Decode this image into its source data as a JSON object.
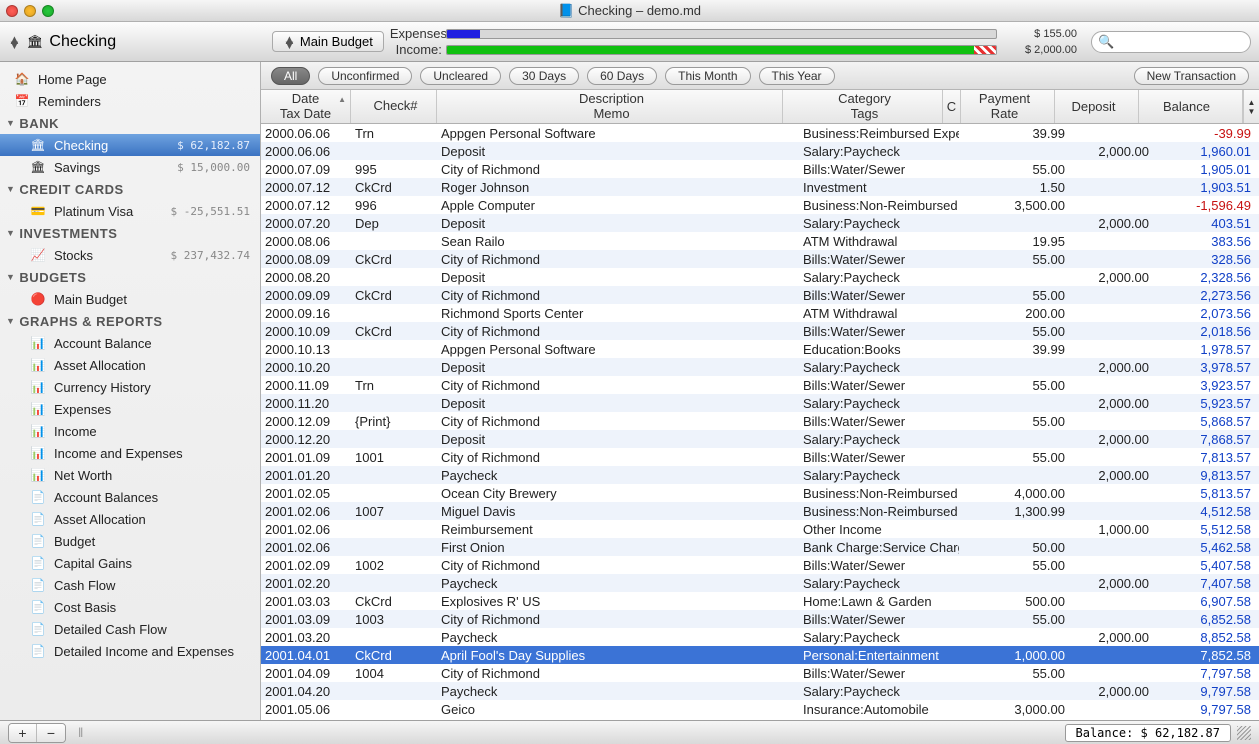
{
  "window": {
    "title": "Checking – demo.md"
  },
  "toolbar": {
    "account_label": "Checking",
    "budget_label": "Main Budget",
    "expenses_label": "Expenses:",
    "income_label": "Income:",
    "expenses_amount": "$ 155.00",
    "income_amount": "$ 2,000.00",
    "expense_fill_pct": 6,
    "income_fill_pct": 96
  },
  "sidebar": {
    "top": [
      {
        "label": "Home Page",
        "icon": "🏠"
      },
      {
        "label": "Reminders",
        "icon": "📅"
      }
    ],
    "groups": [
      {
        "title": "BANK",
        "items": [
          {
            "label": "Checking",
            "amount": "$ 62,182.87",
            "selected": true,
            "icon": "🏛"
          },
          {
            "label": "Savings",
            "amount": "$ 15,000.00",
            "icon": "🏛"
          }
        ]
      },
      {
        "title": "CREDIT CARDS",
        "items": [
          {
            "label": "Platinum Visa",
            "amount": "$ -25,551.51",
            "icon": "💳"
          }
        ]
      },
      {
        "title": "INVESTMENTS",
        "items": [
          {
            "label": "Stocks",
            "amount": "$ 237,432.74",
            "icon": "📈"
          }
        ]
      },
      {
        "title": "BUDGETS",
        "items": [
          {
            "label": "Main Budget",
            "icon": "🔴"
          }
        ]
      },
      {
        "title": "GRAPHS & REPORTS",
        "items": [
          {
            "label": "Account Balance",
            "icon": "📊"
          },
          {
            "label": "Asset Allocation",
            "icon": "📊"
          },
          {
            "label": "Currency History",
            "icon": "📊"
          },
          {
            "label": "Expenses",
            "icon": "📊"
          },
          {
            "label": "Income",
            "icon": "📊"
          },
          {
            "label": "Income and Expenses",
            "icon": "📊"
          },
          {
            "label": "Net Worth",
            "icon": "📊"
          },
          {
            "label": "Account Balances",
            "icon": "📄"
          },
          {
            "label": "Asset Allocation",
            "icon": "📄"
          },
          {
            "label": "Budget",
            "icon": "📄"
          },
          {
            "label": "Capital Gains",
            "icon": "📄"
          },
          {
            "label": "Cash Flow",
            "icon": "📄"
          },
          {
            "label": "Cost Basis",
            "icon": "📄"
          },
          {
            "label": "Detailed Cash Flow",
            "icon": "📄"
          },
          {
            "label": "Detailed Income and Expenses",
            "icon": "📄"
          }
        ]
      }
    ]
  },
  "filters": {
    "pills": [
      "All",
      "Unconfirmed",
      "Uncleared",
      "30 Days",
      "60 Days",
      "This Month",
      "This Year"
    ],
    "active": 0,
    "new_tx": "New Transaction"
  },
  "columns": {
    "date": [
      "Date",
      "Tax Date"
    ],
    "check": [
      "Check#",
      ""
    ],
    "desc": [
      "Description",
      "Memo"
    ],
    "cat": [
      "Category",
      "Tags"
    ],
    "c": [
      "C",
      ""
    ],
    "pay": [
      "Payment",
      "Rate"
    ],
    "dep": [
      "Deposit",
      ""
    ],
    "bal": [
      "Balance",
      ""
    ]
  },
  "transactions": [
    {
      "date": "2000.06.06",
      "check": "Trn",
      "desc": "Appgen Personal Software",
      "cat": "Business:Reimbursed Expenses",
      "pay": "39.99",
      "dep": "",
      "bal": "-39.99",
      "neg": true
    },
    {
      "date": "2000.06.06",
      "check": "",
      "desc": "Deposit",
      "cat": "Salary:Paycheck",
      "pay": "",
      "dep": "2,000.00",
      "bal": "1,960.01"
    },
    {
      "date": "2000.07.09",
      "check": "995",
      "desc": "City of Richmond",
      "cat": "Bills:Water/Sewer",
      "pay": "55.00",
      "dep": "",
      "bal": "1,905.01"
    },
    {
      "date": "2000.07.12",
      "check": "CkCrd",
      "desc": "Roger Johnson",
      "cat": "Investment",
      "pay": "1.50",
      "dep": "",
      "bal": "1,903.51"
    },
    {
      "date": "2000.07.12",
      "check": "996",
      "desc": "Apple Computer",
      "cat": "Business:Non-Reimbursed Expenses",
      "pay": "3,500.00",
      "dep": "",
      "bal": "-1,596.49",
      "neg": true
    },
    {
      "date": "2000.07.20",
      "check": "Dep",
      "desc": "Deposit",
      "cat": "Salary:Paycheck",
      "pay": "",
      "dep": "2,000.00",
      "bal": "403.51"
    },
    {
      "date": "2000.08.06",
      "check": "",
      "desc": "Sean Railo",
      "cat": "ATM Withdrawal",
      "pay": "19.95",
      "dep": "",
      "bal": "383.56"
    },
    {
      "date": "2000.08.09",
      "check": "CkCrd",
      "desc": "City of Richmond",
      "cat": "Bills:Water/Sewer",
      "pay": "55.00",
      "dep": "",
      "bal": "328.56"
    },
    {
      "date": "2000.08.20",
      "check": "",
      "desc": "Deposit",
      "cat": "Salary:Paycheck",
      "pay": "",
      "dep": "2,000.00",
      "bal": "2,328.56"
    },
    {
      "date": "2000.09.09",
      "check": "CkCrd",
      "desc": "City of Richmond",
      "cat": "Bills:Water/Sewer",
      "pay": "55.00",
      "dep": "",
      "bal": "2,273.56"
    },
    {
      "date": "2000.09.16",
      "check": "",
      "desc": "Richmond Sports Center",
      "cat": "ATM Withdrawal",
      "pay": "200.00",
      "dep": "",
      "bal": "2,073.56"
    },
    {
      "date": "2000.10.09",
      "check": "CkCrd",
      "desc": "City of Richmond",
      "cat": "Bills:Water/Sewer",
      "pay": "55.00",
      "dep": "",
      "bal": "2,018.56"
    },
    {
      "date": "2000.10.13",
      "check": "",
      "desc": "Appgen Personal Software",
      "cat": "Education:Books",
      "pay": "39.99",
      "dep": "",
      "bal": "1,978.57"
    },
    {
      "date": "2000.10.20",
      "check": "",
      "desc": "Deposit",
      "cat": "Salary:Paycheck",
      "pay": "",
      "dep": "2,000.00",
      "bal": "3,978.57"
    },
    {
      "date": "2000.11.09",
      "check": "Trn",
      "desc": "City of Richmond",
      "cat": "Bills:Water/Sewer",
      "pay": "55.00",
      "dep": "",
      "bal": "3,923.57"
    },
    {
      "date": "2000.11.20",
      "check": "",
      "desc": "Deposit",
      "cat": "Salary:Paycheck",
      "pay": "",
      "dep": "2,000.00",
      "bal": "5,923.57"
    },
    {
      "date": "2000.12.09",
      "check": "{Print}",
      "desc": "City of Richmond",
      "cat": "Bills:Water/Sewer",
      "pay": "55.00",
      "dep": "",
      "bal": "5,868.57"
    },
    {
      "date": "2000.12.20",
      "check": "",
      "desc": "Deposit",
      "cat": "Salary:Paycheck",
      "pay": "",
      "dep": "2,000.00",
      "bal": "7,868.57"
    },
    {
      "date": "2001.01.09",
      "check": "1001",
      "desc": "City of Richmond",
      "cat": "Bills:Water/Sewer",
      "pay": "55.00",
      "dep": "",
      "bal": "7,813.57"
    },
    {
      "date": "2001.01.20",
      "check": "",
      "desc": "Paycheck",
      "cat": "Salary:Paycheck",
      "pay": "",
      "dep": "2,000.00",
      "bal": "9,813.57"
    },
    {
      "date": "2001.02.05",
      "check": "",
      "desc": "Ocean City Brewery",
      "cat": "Business:Non-Reimbursed Expenses",
      "pay": "4,000.00",
      "dep": "",
      "bal": "5,813.57"
    },
    {
      "date": "2001.02.06",
      "check": "1007",
      "desc": "Miguel Davis",
      "cat": "Business:Non-Reimbursed Expenses",
      "pay": "1,300.99",
      "dep": "",
      "bal": "4,512.58"
    },
    {
      "date": "2001.02.06",
      "check": "",
      "desc": "Reimbursement",
      "cat": "Other Income",
      "pay": "",
      "dep": "1,000.00",
      "bal": "5,512.58"
    },
    {
      "date": "2001.02.06",
      "check": "",
      "desc": "First Onion",
      "cat": "Bank Charge:Service Charge",
      "pay": "50.00",
      "dep": "",
      "bal": "5,462.58"
    },
    {
      "date": "2001.02.09",
      "check": "1002",
      "desc": "City of Richmond",
      "cat": "Bills:Water/Sewer",
      "pay": "55.00",
      "dep": "",
      "bal": "5,407.58"
    },
    {
      "date": "2001.02.20",
      "check": "",
      "desc": "Paycheck",
      "cat": "Salary:Paycheck",
      "pay": "",
      "dep": "2,000.00",
      "bal": "7,407.58"
    },
    {
      "date": "2001.03.03",
      "check": "CkCrd",
      "desc": "Explosives R' US",
      "cat": "Home:Lawn & Garden",
      "pay": "500.00",
      "dep": "",
      "bal": "6,907.58"
    },
    {
      "date": "2001.03.09",
      "check": "1003",
      "desc": "City of Richmond",
      "cat": "Bills:Water/Sewer",
      "pay": "55.00",
      "dep": "",
      "bal": "6,852.58"
    },
    {
      "date": "2001.03.20",
      "check": "",
      "desc": "Paycheck",
      "cat": "Salary:Paycheck",
      "pay": "",
      "dep": "2,000.00",
      "bal": "8,852.58"
    },
    {
      "date": "2001.04.01",
      "check": "CkCrd",
      "desc": "April Fool's Day Supplies",
      "cat": "Personal:Entertainment",
      "pay": "1,000.00",
      "dep": "",
      "bal": "7,852.58",
      "sel": true
    },
    {
      "date": "2001.04.09",
      "check": "1004",
      "desc": "City of Richmond",
      "cat": "Bills:Water/Sewer",
      "pay": "55.00",
      "dep": "",
      "bal": "7,797.58"
    },
    {
      "date": "2001.04.20",
      "check": "",
      "desc": "Paycheck",
      "cat": "Salary:Paycheck",
      "pay": "",
      "dep": "2,000.00",
      "bal": "9,797.58"
    },
    {
      "date": "2001.05.06",
      "check": "",
      "desc": "Geico",
      "cat": "Insurance:Automobile",
      "pay": "3,000.00",
      "dep": "",
      "bal": "9,797.58"
    }
  ],
  "status": {
    "balance": "Balance: $ 62,182.87"
  }
}
